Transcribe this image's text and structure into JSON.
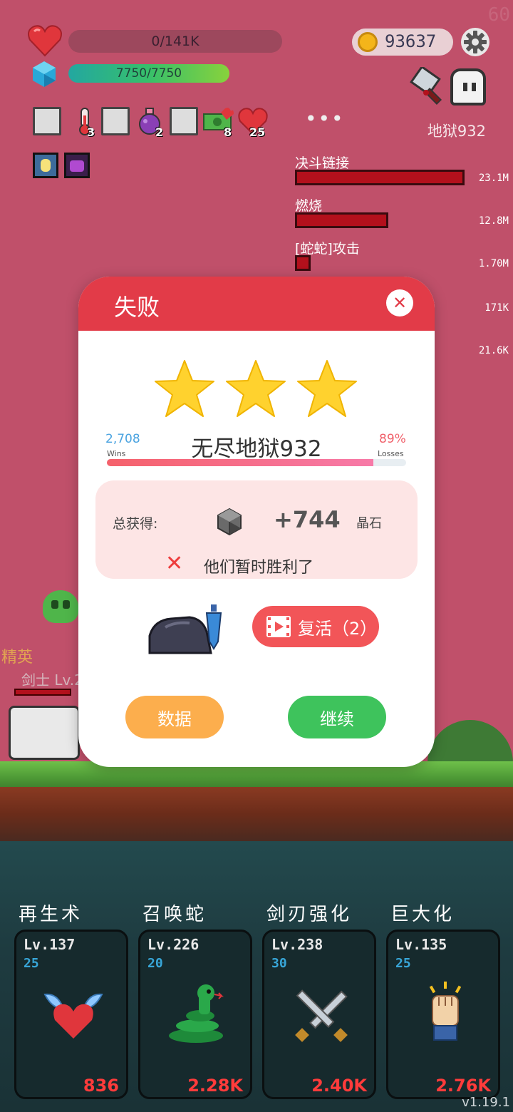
{
  "hud": {
    "fps": "60",
    "hp_text": "0/141K",
    "mp_text": "7750/7750",
    "coins": "93637",
    "stage_label": "地狱932"
  },
  "items": [
    {
      "icon": "scroll-icon",
      "count": ""
    },
    {
      "icon": "thermometer-icon",
      "count": "3"
    },
    {
      "icon": "scroll-icon",
      "count": ""
    },
    {
      "icon": "potion-icon",
      "count": "2"
    },
    {
      "icon": "scroll-icon",
      "count": ""
    },
    {
      "icon": "cash-icon",
      "count": "8"
    },
    {
      "icon": "heart-icon",
      "count": "25"
    }
  ],
  "damage_stats": [
    {
      "label": "决斗链接",
      "value": "23.1M",
      "fraction": 1.0
    },
    {
      "label": "燃烧",
      "value": "12.8M",
      "fraction": 0.55
    },
    {
      "label": "[蛇蛇]攻击",
      "value": "1.70M",
      "fraction": 0.074
    },
    {
      "label": "",
      "value": "171K",
      "fraction": 0.0074
    },
    {
      "label": "",
      "value": "21.6K",
      "fraction": 0.001
    }
  ],
  "scene": {
    "ghost_text1": "精英",
    "ghost_text2": "剑士 Lv.2"
  },
  "dialog": {
    "title": "失败",
    "close": "✕",
    "stars": 3,
    "wins_num": "2,708",
    "wins_label": "Wins",
    "losses_pct": "89%",
    "losses_label": "Losses",
    "progress": 0.89,
    "stage_name": "无尽地狱932",
    "reward_label": "总获得:",
    "reward_amount": "+744",
    "reward_unit": "晶石",
    "reward_msg": "他们暂时胜利了",
    "revive_label": "复活（2）",
    "data_button": "数据",
    "continue_button": "继续"
  },
  "skills": [
    {
      "title": "再生术",
      "level": "Lv.137",
      "cost": "25",
      "price": "836",
      "icon": "winged-heart-icon"
    },
    {
      "title": "召唤蛇",
      "level": "Lv.226",
      "cost": "20",
      "price": "2.28K",
      "icon": "snake-icon"
    },
    {
      "title": "剑刃强化",
      "level": "Lv.238",
      "cost": "30",
      "price": "2.40K",
      "icon": "crossed-swords-icon"
    },
    {
      "title": "巨大化",
      "level": "Lv.135",
      "cost": "25",
      "price": "2.76K",
      "icon": "fist-icon"
    }
  ],
  "version": "v1.19.1",
  "colors": {
    "background": "#c0506a",
    "dialog_header": "#e23b48",
    "data_button": "#fcae4d",
    "continue_button": "#3ec35c",
    "price_red": "#ff3b3b"
  }
}
